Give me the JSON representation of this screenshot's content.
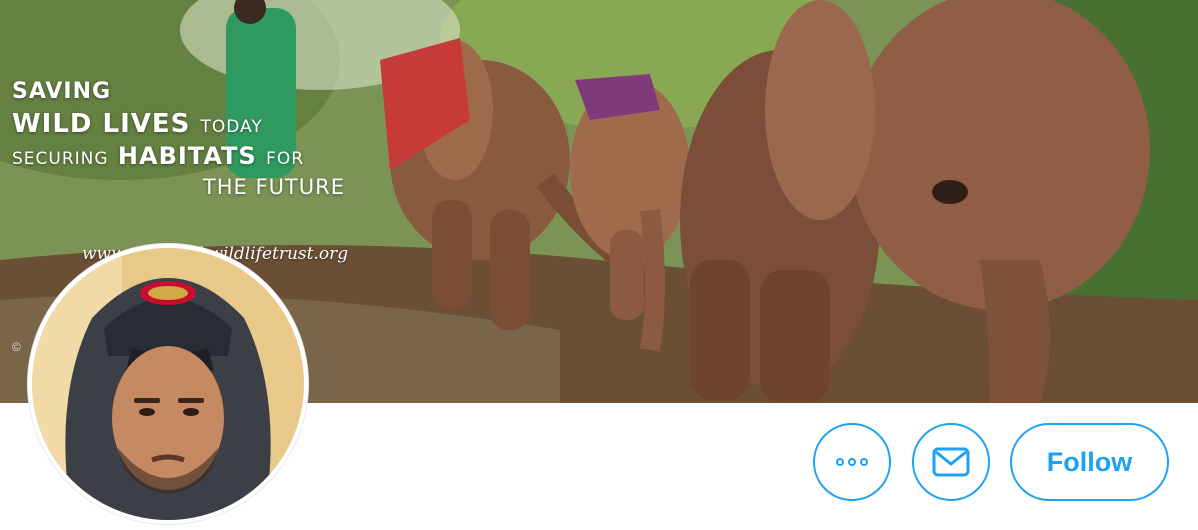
{
  "banner": {
    "line1": "SAVING",
    "line2_big": "WILD LIVES",
    "line2_small": "TODAY",
    "line3_small_a": "SECURING",
    "line3_big": "HABITATS",
    "line3_small_b": "FOR",
    "line4": "THE FUTURE",
    "url": "www.sheldrickwildlifetrust.org",
    "copyright": "©"
  },
  "actions": {
    "more_label": "More",
    "message_label": "Message",
    "follow_label": "Follow"
  },
  "colors": {
    "accent": "#1da1f2",
    "background": "#ffffff"
  },
  "icons": {
    "more": "more-dots-icon",
    "message": "envelope-icon"
  }
}
